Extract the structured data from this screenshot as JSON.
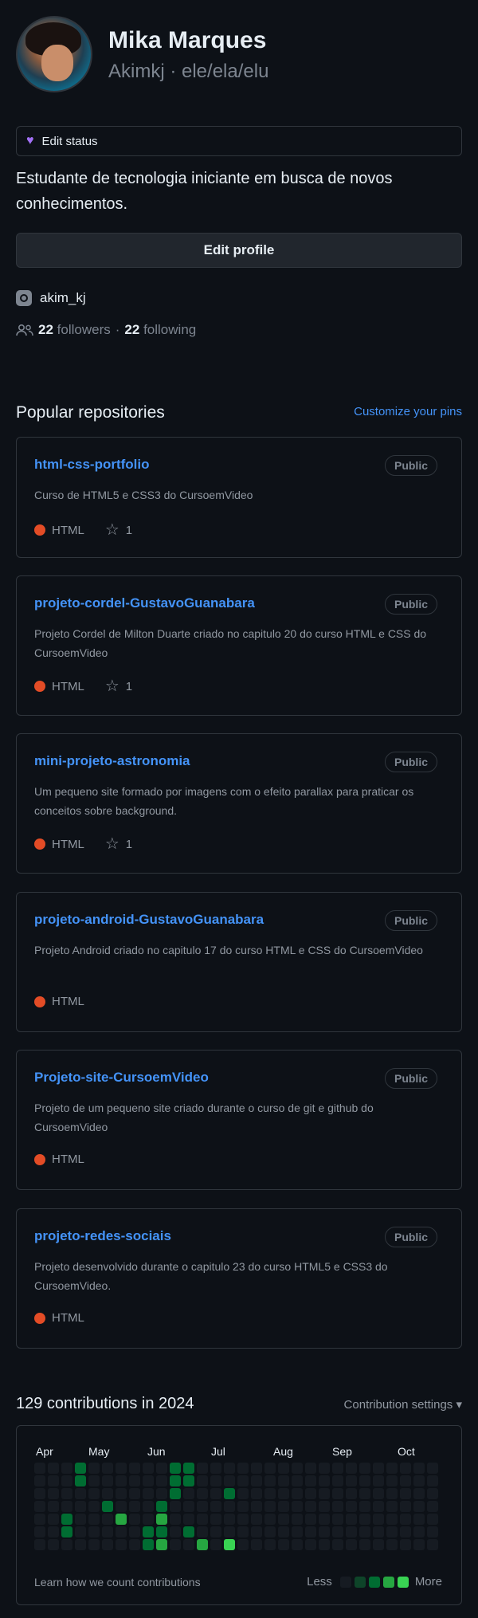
{
  "profile": {
    "name": "Mika Marques",
    "handle": "Akimkj · ele/ela/elu",
    "edit_status": "Edit status",
    "bio": "Estudante de tecnologia iniciante em busca de novos conhecimentos.",
    "edit_profile": "Edit profile",
    "social": "akim_kj",
    "followers_count": "22",
    "followers_label": "followers",
    "separator": "·",
    "following_count": "22",
    "following_label": "following"
  },
  "popular": {
    "title": "Popular repositories",
    "customize": "Customize your pins",
    "repos": [
      {
        "name": "html-css-portfolio",
        "badge": "Public",
        "desc": "Curso de HTML5 e CSS3 do CursoemVideo",
        "lang": "HTML",
        "stars": "1"
      },
      {
        "name": "projeto-cordel-GustavoGuanabara",
        "badge": "Public",
        "desc": "Projeto Cordel de Milton Duarte criado no capitulo 20 do curso HTML e CSS do CursoemVideo",
        "lang": "HTML",
        "stars": "1"
      },
      {
        "name": "mini-projeto-astronomia",
        "badge": "Public",
        "desc": "Um pequeno site formado por imagens com o efeito parallax para praticar os conceitos sobre background.",
        "lang": "HTML",
        "stars": "1"
      },
      {
        "name": "projeto-android-GustavoGuanabara",
        "badge": "Public",
        "desc": "Projeto Android criado no capitulo 17 do curso HTML e CSS do CursoemVideo",
        "lang": "HTML",
        "stars": ""
      },
      {
        "name": "Projeto-site-CursoemVideo",
        "badge": "Public",
        "desc": "Projeto de um pequeno site criado durante o curso de git e github do CursoemVideo",
        "lang": "HTML",
        "stars": ""
      },
      {
        "name": "projeto-redes-sociais",
        "badge": "Public",
        "desc": "Projeto desenvolvido durante o capitulo 23 do curso HTML5 e CSS3 do CursoemVideo.",
        "lang": "HTML",
        "stars": ""
      }
    ]
  },
  "contributions": {
    "title": "129 contributions in 2024",
    "settings": "Contribution settings ▾",
    "months": [
      "Apr",
      "May",
      "Jun",
      "Jul",
      "Aug",
      "Sep",
      "Oct"
    ],
    "learn": "Learn how we count contributions",
    "less": "Less",
    "more": "More",
    "colors": {
      "empty": "#161b22",
      "l1": "#0e4429",
      "l2": "#006d32",
      "l3": "#26a641",
      "l4": "#39d353"
    }
  }
}
